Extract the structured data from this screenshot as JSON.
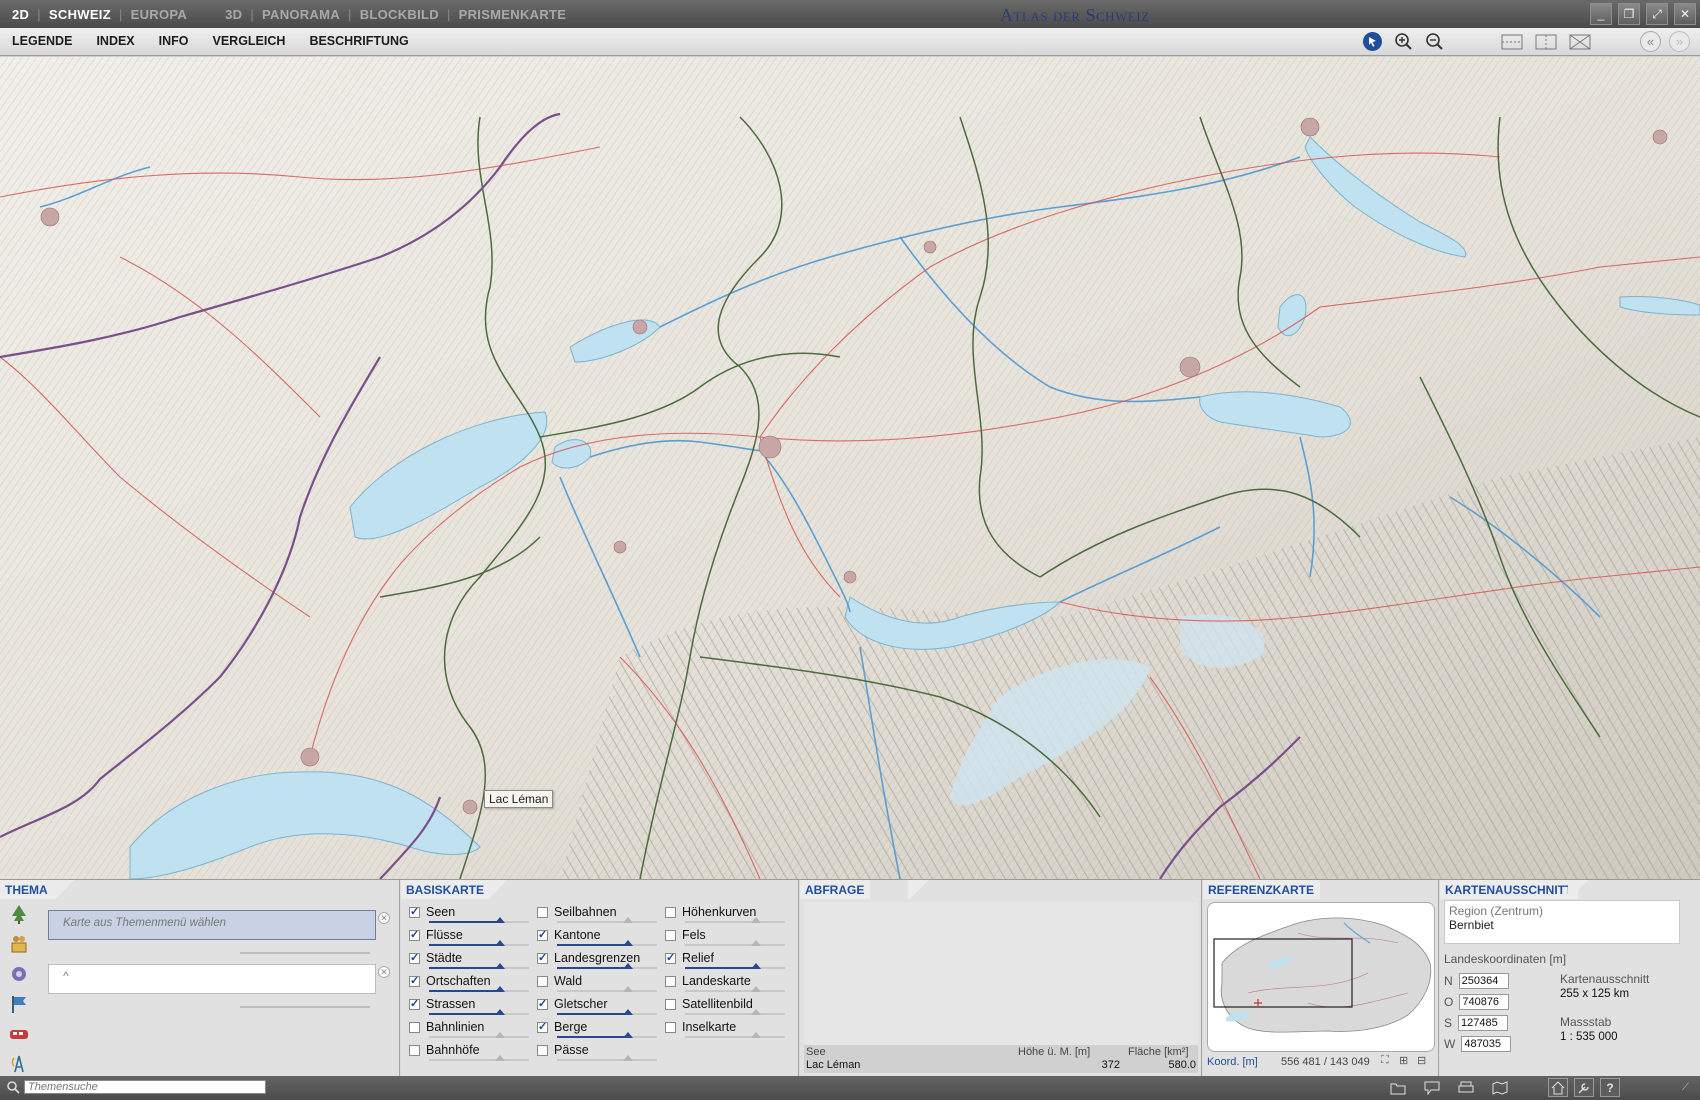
{
  "titlebar": {
    "mode_2d": "2D",
    "tab_schweiz": "SCHWEIZ",
    "tab_europa": "EUROPA",
    "mode_3d": "3D",
    "tab_panorama": "PANORAMA",
    "tab_blockbild": "BLOCKBILD",
    "tab_prismenkarte": "PRISMENKARTE",
    "app_title": "Atlas der Schweiz"
  },
  "menu": {
    "legende": "LEGENDE",
    "index": "INDEX",
    "info": "INFO",
    "vergleich": "VERGLEICH",
    "beschriftung": "BESCHRIFTUNG"
  },
  "map": {
    "tooltip": "Lac Léman",
    "colors": {
      "lake": "#bfe1f0",
      "land": "#ece9e2",
      "canton_border": "#4c6b3c",
      "national_border": "#7a4f8c",
      "road": "#d9544f",
      "river": "#5a9fd4"
    }
  },
  "thema": {
    "title": "THEMA",
    "field1_placeholder": "Karte aus Themenmenü wählen",
    "field2_placeholder": "^"
  },
  "basiskarte": {
    "title": "BASISKARTE",
    "col1": [
      {
        "label": "Seen",
        "checked": true
      },
      {
        "label": "Flüsse",
        "checked": true
      },
      {
        "label": "Städte",
        "checked": true
      },
      {
        "label": "Ortschaften",
        "checked": true
      },
      {
        "label": "Strassen",
        "checked": true
      },
      {
        "label": "Bahnlinien",
        "checked": false
      },
      {
        "label": "Bahnhöfe",
        "checked": false
      }
    ],
    "col2": [
      {
        "label": "Seilbahnen",
        "checked": false
      },
      {
        "label": "Kantone",
        "checked": true
      },
      {
        "label": "Landesgrenzen",
        "checked": true
      },
      {
        "label": "Wald",
        "checked": false
      },
      {
        "label": "Gletscher",
        "checked": true
      },
      {
        "label": "Berge",
        "checked": true
      },
      {
        "label": "Pässe",
        "checked": false
      }
    ],
    "col3": [
      {
        "label": "Höhenkurven",
        "checked": false
      },
      {
        "label": "Fels",
        "checked": false
      },
      {
        "label": "Relief",
        "checked": true
      },
      {
        "label": "Landeskarte",
        "checked": false
      },
      {
        "label": "Satellitenbild",
        "checked": false
      },
      {
        "label": "Inselkarte",
        "checked": false
      }
    ]
  },
  "abfrage": {
    "title": "ABFRAGE",
    "col_see": "See",
    "col_hoehe": "Höhe ü. M. [m]",
    "col_flaeche": "Fläche [km²]",
    "val_see": "Lac Léman",
    "val_hoehe": "372",
    "val_flaeche": "580.0"
  },
  "referenzkarte": {
    "title": "REFERENZKARTE",
    "koord_label": "Koord. [m]",
    "koord_value": "556 481 / 143 049"
  },
  "kartenausschnitt": {
    "title": "KARTENAUSSCHNITT",
    "region_label": "Region (Zentrum)",
    "region_value": "Bernbiet",
    "coords_label": "Landeskoordinaten [m]",
    "n_label": "N",
    "n_value": "250364",
    "o_label": "O",
    "o_value": "740876",
    "s_label": "S",
    "s_value": "127485",
    "w_label": "W",
    "w_value": "487035",
    "ausschnitt_label": "Kartenausschnitt",
    "ausschnitt_value": "255 x 125 km",
    "massstab_label": "Massstab",
    "massstab_value": "1 : 535 000"
  },
  "statusbar": {
    "search_placeholder": "Themensuche"
  }
}
